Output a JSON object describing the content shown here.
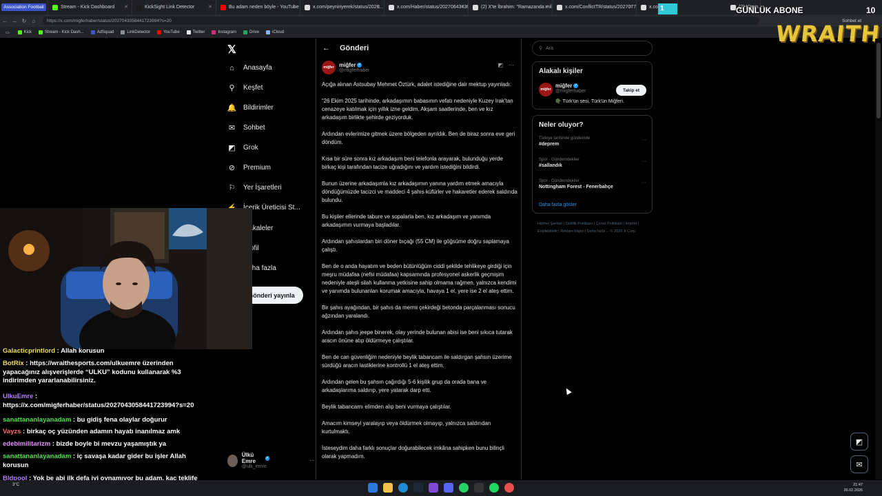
{
  "browser": {
    "tabs": [
      {
        "label": "Association Football",
        "color": "#3c56c9"
      },
      {
        "label": "Stream - Kick Dashboard",
        "color": "#53fc18"
      },
      {
        "label": "KickSight Link Detector",
        "color": "#1b1b1b"
      },
      {
        "label": "Bu adam neden böyle - YouTube",
        "color": "#ff0000"
      },
      {
        "label": "x.com/peyniriyerek/status/2026...",
        "color": "#dddddd"
      },
      {
        "label": "x.com/Haber/status/20270643436...",
        "color": "#dddddd"
      },
      {
        "label": "(2) X'te İbrahim: \"Ramazanda mil...",
        "color": "#dddddd"
      },
      {
        "label": "x.com/ConflictTR/status/2027077...",
        "color": "#dddddd"
      },
      {
        "label": "x.com/hom...",
        "color": "#dddddd"
      },
      {
        "label": "(2) X'te n...",
        "color": "#dddddd"
      }
    ],
    "url": "https://x.com/migferhaber/status/2027043058441723994?s=20",
    "bookmarks": [
      {
        "label": "Kick",
        "color": "#53fc18"
      },
      {
        "label": "Stream - Kick Dash...",
        "color": "#53fc18"
      },
      {
        "label": "AdSquad",
        "color": "#3c56c9"
      },
      {
        "label": "LinkDetector",
        "color": "#8a8f96"
      },
      {
        "label": "YouTube",
        "color": "#ff0000"
      },
      {
        "label": "Twitter",
        "color": "#e7e9ea"
      },
      {
        "label": "Instagram",
        "color": "#d6307a"
      },
      {
        "label": "Drive",
        "color": "#1fa463"
      },
      {
        "label": "iCloud",
        "color": "#8ab4f8"
      }
    ],
    "profile_label": "Sohbet et"
  },
  "x_nav": {
    "logo": "𝕏",
    "items": [
      {
        "label": "Anasayfa",
        "icon": "home-icon",
        "glyph": "⌂"
      },
      {
        "label": "Keşfet",
        "icon": "search-icon",
        "glyph": "⚲"
      },
      {
        "label": "Bildirimler",
        "icon": "bell-icon",
        "glyph": "🔔"
      },
      {
        "label": "Sohbet",
        "icon": "mail-icon",
        "glyph": "✉"
      },
      {
        "label": "Grok",
        "icon": "grok-icon",
        "glyph": "◩"
      },
      {
        "label": "Premium",
        "icon": "premium-icon",
        "glyph": "⊘"
      },
      {
        "label": "Yer İşaretleri",
        "icon": "bookmark-icon",
        "glyph": "⚐"
      },
      {
        "label": "İçerik Üreticisi St...",
        "icon": "creator-studio-icon",
        "glyph": "⚡"
      },
      {
        "label": "Makaleler",
        "icon": "articles-icon",
        "glyph": "▤"
      },
      {
        "label": "Profil",
        "icon": "profile-icon",
        "glyph": "☺"
      },
      {
        "label": "Daha fazla",
        "icon": "more-icon",
        "glyph": "⋯"
      }
    ],
    "post_button": "Gönderi yayınla",
    "profile": {
      "name": "Ülkü Emre",
      "handle": "@ulk_emre"
    }
  },
  "post": {
    "header": "Gönderi",
    "author": {
      "name": "miğfer",
      "handle": "@migferhaber",
      "avatar_text": "miğfer"
    },
    "paragraphs": [
      "Açığa alınan Astsubay Mehmet Öztürk, adalet istediğine dair mektup yayınladı:",
      "“26 Ekim 2025 tarihinde, arkadaşımın babasının vefatı nedeniyle Kuzey Irak’tan cenazeye katılmak için yıllık izne geldim. Akşam saatlerinde, ben ve kız arkadaşım birlikte şehirde geziyorduk.",
      "Ardından evlerimize gitmek üzere bölgeden ayrıldık. Ben de biraz sonra eve geri döndüm.",
      "Kısa bir süre sonra kız arkadaşım beni telefonla arayarak, bulunduğu yerde birkaç kişi tarafından tacize uğradığını ve yardım istediğini bildirdi.",
      "Bunun üzerine arkadaşımla kız arkadaşımın yanına yardım etmek amacıyla döndüğümüzde tacizci ve maddeci 4 şahıs küfürler ve hakaretler ederek saldırıda bulundu.",
      "Bu kişiler ellerinde tabure ve sopalarla ben, kız arkadaşım ve yanımda arkadaşımın vurmaya başladılar.",
      "Ardından şahıslardan biri döner bıçağı (55 CM) ile göğsüme doğru saplamaya çalıştı.",
      "Ben de o anda hayatım ve beden bütünlüğüm ciddi şekilde tehlikeye girdiği için meşru müdafaa (nefsi müdafaa) kapsamında profesyonel askerlik geçmişim nedeniyle ateşli silah kullanma yetkisine sahip olmama rağmen, yalnızca kendimi ve yanımda bulunanları korumak amacıyla, havaya 1 el, yere ise 2 el ateş ettim.",
      "Bir şahıs ayağından, bir şahıs da mermi çekirdeği betonda parçalanması sonucu ağzından yaralandı.",
      "Ardından şahıs jeepe binerek, olay yerinde bulunan abisi ise beni sıkıca tutarak aracın önüne atıp öldürmeye çalıştılar.",
      "Ben de can güvenliğim nedeniyle beylik tabancam ile saldırgan şahsın üzerime sürdüğü aracın lastiklerine kontrollü 1 el ateş ettim.",
      "Ardından gelen bu şahsın çağırdığı 5-6 kişilik grup da orada bana ve arkadaşlarıma saldırıp, yere yatarak darp etti.",
      "Beylik tabancamı elimden alıp beni vurmaya çalıştılar.",
      "Amacım kimseyi yaralayıp veya öldürmek olmayıp, yalnızca saldırıdan kurtulmaktı.",
      "İsteseydim daha farklı sonuçlar doğurabilecek imkâna sahipken bunu bilinçli olarak yapmadım."
    ]
  },
  "right": {
    "search_placeholder": "Ara",
    "related_title": "Alakalı kişiler",
    "related": {
      "name": "miğfer",
      "handle": "@migferhaber",
      "bio": "🪖 Türk'ün sesi, Türk'ün Miğferi.",
      "follow": "Takip et"
    },
    "trends_title": "Neler oluyor?",
    "trends": [
      {
        "context": "Türkiye tarihinde gündemde",
        "name": "#deprem"
      },
      {
        "context": "Spor · Gündemdekiler",
        "name": "#sallandık"
      },
      {
        "context": "Spor · Gündemdekiler",
        "name": "Nottingham Forest - Fenerbahçe"
      }
    ],
    "show_more": "Daha fazla göster",
    "footer": "Hizmet Şartları  |  Gizlilik Politikası  |  Çerez Politikası  |  İmprint  |  Erişilebilirlik  |  Reklam bilgisi  |  Daha fazla ...  © 2026 X Corp."
  },
  "overlay": {
    "sub_number": "1",
    "sub_label": "GÜNLÜK ABONE",
    "sub_count": "10",
    "brand": "WRAITH"
  },
  "chat": [
    {
      "user": "Galacticprintlord",
      "color": "#f2e34b",
      "text": " : Allah korusun"
    },
    {
      "user": "BotRix",
      "color": "#f2e34b",
      "text": " : https://wraithesports.com/ulkuemre üzerinden yapacağınız alışverişlerde “ULKU” kodunu kullanarak %3 indirimden yararlanabilirsiniz."
    },
    {
      "user": "UlkuEmre",
      "color": "#b57cff",
      "text": " : https://x.com/migferhaber/status/2027043058441723994?s=20"
    },
    {
      "user": "sanattananlayanadam",
      "color": "#4be34b",
      "text": " : bu gidiş fena olaylar doğurur"
    },
    {
      "user": "Vayzs",
      "color": "#ff6b6b",
      "text": " : birkaç oç yüzünden adamın hayatı inanılmaz amk"
    },
    {
      "user": "edebimilitarizm",
      "color": "#e58cff",
      "text": " : bizde boyle bi mevzu yaşamıştık ya"
    },
    {
      "user": "sanattananlayanadam",
      "color": "#4be34b",
      "text": " : iç savaşa kadar gider bu işler Allah korusun"
    },
    {
      "user": "Bldpool",
      "color": "#b57cff",
      "text": " : Yok be abi ilk defa iyi oynamıyor bu adam, kaç teklife sağarsın mesela ve yerine kimi alıcan"
    }
  ],
  "taskbar": {
    "weather": "3°C",
    "time": "21:47",
    "date": "26.02.2026"
  }
}
